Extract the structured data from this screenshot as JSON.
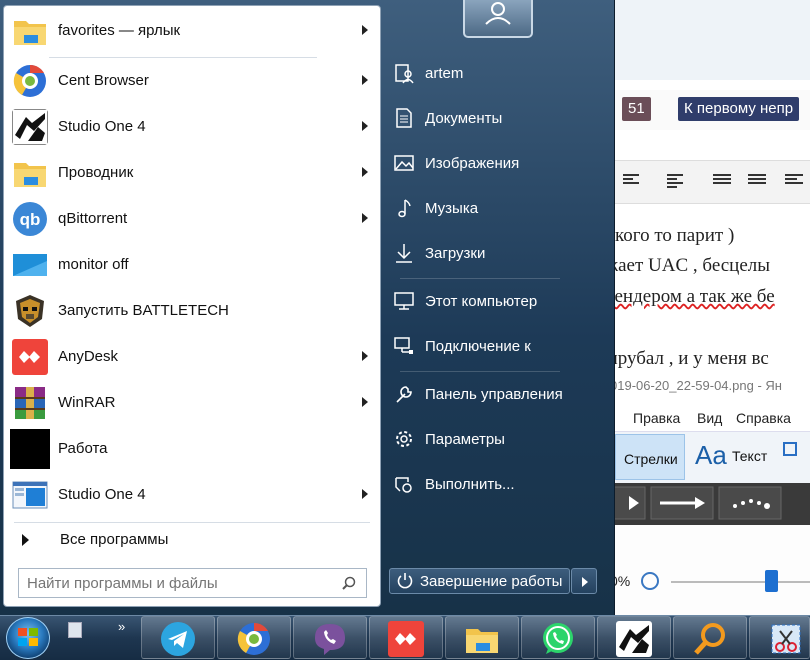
{
  "background_app": {
    "badge_count": "51",
    "badge_link": "К первому непр",
    "editor_lines": [
      "кого то парит )",
      "жает UAC ,  бесцелы",
      "рендером а так же бе",
      "ырубал , и у меня вс"
    ],
    "filename": "019-06-20_22-59-04.png - Ян",
    "menu": [
      "Правка",
      "Вид",
      "Справка"
    ],
    "ribbon": {
      "arrows_label": "Стрелки",
      "text_label": "Текст"
    },
    "zoom": "0%"
  },
  "start_menu": {
    "programs": [
      {
        "label": "favorites — ярлык",
        "icon": "folder-icon",
        "submenu": true
      },
      {
        "label": "Cent Browser",
        "icon": "cent-browser-icon",
        "submenu": true
      },
      {
        "label": "Studio One 4",
        "icon": "studio-one-icon",
        "submenu": true
      },
      {
        "label": "Проводник",
        "icon": "folder-icon",
        "submenu": true
      },
      {
        "label": "qBittorrent",
        "icon": "qbittorrent-icon",
        "submenu": true
      },
      {
        "label": "monitor off",
        "icon": "monitor-icon",
        "submenu": false
      },
      {
        "label": "Запустить BATTLETECH",
        "icon": "battletech-icon",
        "submenu": false
      },
      {
        "label": "AnyDesk",
        "icon": "anydesk-icon",
        "submenu": true
      },
      {
        "label": "WinRAR",
        "icon": "winrar-icon",
        "submenu": true
      },
      {
        "label": "Работа",
        "icon": "black-square-icon",
        "submenu": false
      },
      {
        "label": "Studio One 4",
        "icon": "window-icon",
        "submenu": true
      }
    ],
    "all_programs": "Все программы",
    "search_placeholder": "Найти программы и файлы",
    "right_items": [
      {
        "label": "artem",
        "icon": "user-folder-icon"
      },
      {
        "label": "Документы",
        "icon": "document-icon"
      },
      {
        "label": "Изображения",
        "icon": "image-icon"
      },
      {
        "label": "Музыка",
        "icon": "music-icon"
      },
      {
        "label": "Загрузки",
        "icon": "download-icon"
      },
      {
        "label": "Этот компьютер",
        "icon": "computer-icon"
      },
      {
        "label": "Подключение к",
        "icon": "network-icon"
      },
      {
        "label": "Панель управления",
        "icon": "wrench-icon"
      },
      {
        "label": "Параметры",
        "icon": "gear-icon"
      },
      {
        "label": "Выполнить...",
        "icon": "run-icon"
      }
    ],
    "shutdown_label": "Завершение работы"
  },
  "taskbar": {
    "pinned": [
      "telegram-icon",
      "cent-browser-icon",
      "viber-icon",
      "anydesk-icon",
      "explorer-icon",
      "whatsapp-icon",
      "studio-one-icon",
      "search-app-icon",
      "snipping-tool-icon"
    ],
    "overflow": "»"
  },
  "colors": {
    "menu_dark": "#1d3a57",
    "badge_dark": "#6b4e58",
    "badge_navy": "#2f3d6b",
    "anydesk_red": "#ef443b"
  }
}
